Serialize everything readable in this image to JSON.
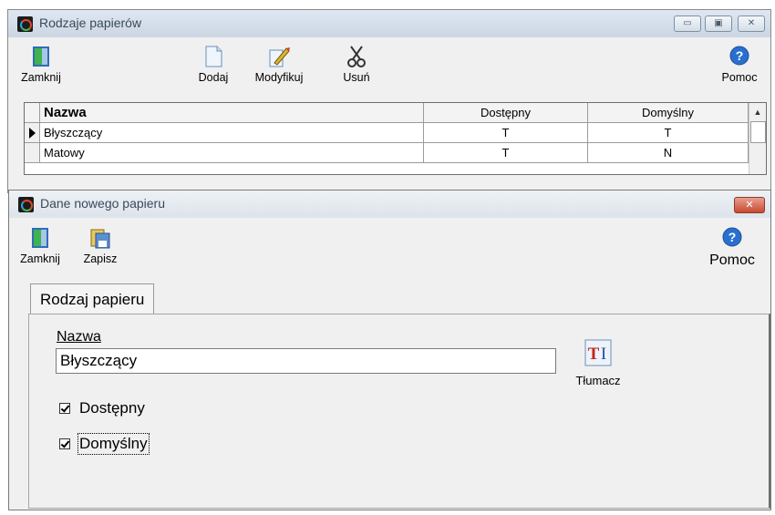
{
  "window1": {
    "title": "Rodzaje papierów",
    "toolbar": {
      "close_label": "Zamknij",
      "add_label": "Dodaj",
      "edit_label": "Modyfikuj",
      "delete_label": "Usuń",
      "help_label": "Pomoc"
    },
    "grid": {
      "columns": [
        "Nazwa",
        "Dostępny",
        "Domyślny"
      ],
      "rows": [
        {
          "name": "Błyszczący",
          "available": "T",
          "default": "T"
        },
        {
          "name": "Matowy",
          "available": "T",
          "default": "N"
        }
      ]
    }
  },
  "window2": {
    "title": "Dane nowego papieru",
    "toolbar": {
      "close_label": "Zamknij",
      "save_label": "Zapisz",
      "help_label": "Pomoc"
    },
    "tab_label": "Rodzaj papieru",
    "name_label": "Nazwa",
    "name_value": "Błyszczący",
    "translate_label": "Tłumacz",
    "checkbox_available": {
      "label": "Dostępny",
      "checked": true
    },
    "checkbox_default": {
      "label": "Domyślny",
      "checked": true
    }
  },
  "colors": {
    "titlebar": "#cbd6e3",
    "window_bg": "#f0f0f0",
    "close_red": "#c8492f",
    "help_blue": "#2a6fcf"
  }
}
